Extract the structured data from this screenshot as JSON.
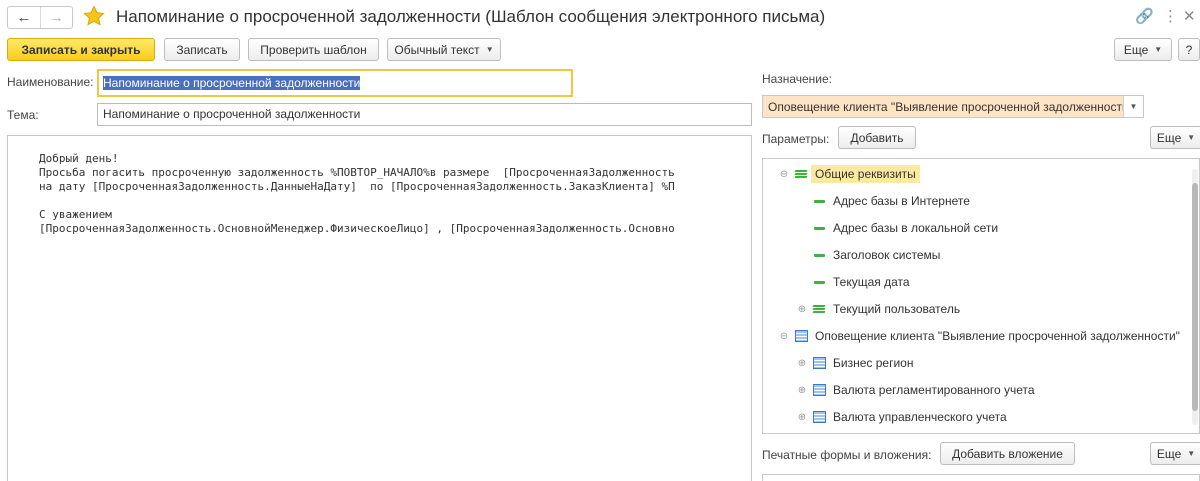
{
  "window": {
    "title": "Напоминание о просроченной задолженности  (Шаблон сообщения электронного письма)",
    "nav_back": "←",
    "nav_forward": "→",
    "link_glyph": "🔗",
    "more_glyph": "⋮",
    "close_glyph": "✕"
  },
  "toolbar": {
    "save_close": "Записать и закрыть",
    "save": "Записать",
    "check_template": "Проверить шаблон",
    "format": "Обычный текст",
    "more": "Еще",
    "help": "?"
  },
  "form": {
    "name_label": "Наименование:",
    "name_value": "Напоминание о просроченной задолженности",
    "subject_label": "Тема:",
    "subject_value": "Напоминание о просроченной задолженности"
  },
  "editor": {
    "lines": [
      "Добрый день!",
      "Просьба погасить просроченную задолженность %ПОВТОР_НАЧАЛО%в размере  [ПросроченнаяЗадолженность",
      "на дату [ПросроченнаяЗадолженность.ДанныеНаДату]  по [ПросроченнаяЗадолженность.ЗаказКлиента] %П",
      "",
      "С уважением",
      "[ПросроченнаяЗадолженность.ОсновнойМенеджер.ФизическоеЛицо] , [ПросроченнаяЗадолженность.Основно"
    ]
  },
  "right": {
    "purpose_label": "Назначение:",
    "purpose_value": "Оповещение клиента \"Выявление просроченной задолженности\"",
    "params_label": "Параметры:",
    "add_button": "Добавить",
    "more": "Еще",
    "tree": [
      {
        "label": "Общие реквизиты",
        "expander": "⊖",
        "icon": "stack-icon"
      },
      {
        "label": "Адрес базы в Интернете",
        "expander": "",
        "icon": "dash-icon"
      },
      {
        "label": "Адрес базы в локальной сети",
        "expander": "",
        "icon": "dash-icon"
      },
      {
        "label": "Заголовок системы",
        "expander": "",
        "icon": "dash-icon"
      },
      {
        "label": "Текущая дата",
        "expander": "",
        "icon": "dash-icon"
      },
      {
        "label": "Текущий пользователь",
        "expander": "⊕",
        "icon": "stack-icon"
      },
      {
        "label": "Оповещение клиента \"Выявление просроченной задолженности\"",
        "expander": "⊖",
        "icon": "list-icon"
      },
      {
        "label": "Бизнес регион",
        "expander": "⊕",
        "icon": "list-icon"
      },
      {
        "label": "Валюта регламентированного учета",
        "expander": "⊕",
        "icon": "list-icon"
      },
      {
        "label": "Валюта управленческого учета",
        "expander": "⊕",
        "icon": "list-icon"
      }
    ],
    "print_label": "Печатные формы и вложения:",
    "add_attachment": "Добавить вложение",
    "more2": "Еще"
  },
  "colors": {
    "accent_yellow": "#f8cd1c",
    "selection_blue": "#4a6fbf",
    "purpose_bg": "#fde4c4",
    "tree_highlight": "#fbe9a2",
    "icon_green": "#3db33d"
  }
}
